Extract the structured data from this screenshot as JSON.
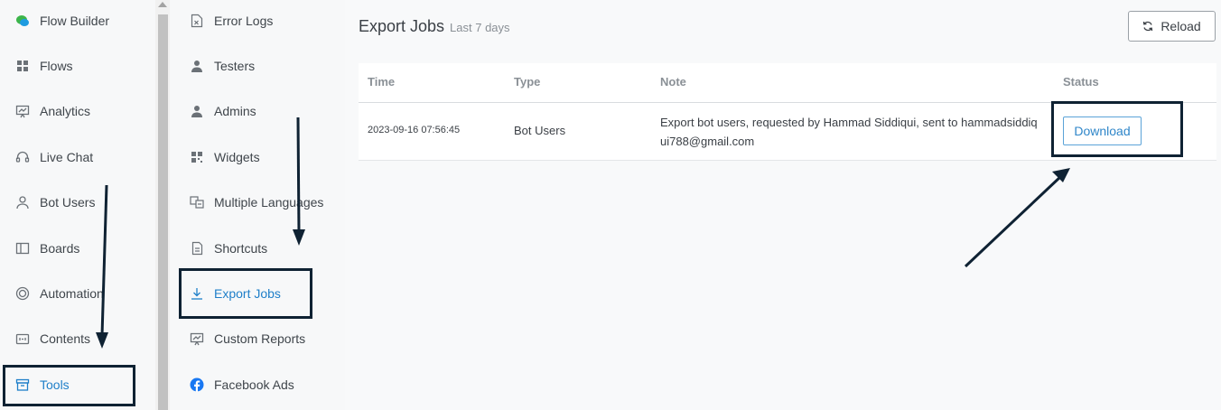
{
  "sidebar": {
    "items": [
      {
        "label": "Flow Builder",
        "icon": "chat-bubble-icon"
      },
      {
        "label": "Flows",
        "icon": "grid-icon"
      },
      {
        "label": "Analytics",
        "icon": "presentation-chart-icon"
      },
      {
        "label": "Live Chat",
        "icon": "headset-icon"
      },
      {
        "label": "Bot Users",
        "icon": "user-icon"
      },
      {
        "label": "Boards",
        "icon": "columns-icon"
      },
      {
        "label": "Automation",
        "icon": "target-icon"
      },
      {
        "label": "Contents",
        "icon": "calendar-icon"
      },
      {
        "label": "Tools",
        "icon": "archive-box-icon",
        "active": true
      }
    ]
  },
  "subnav": {
    "items": [
      {
        "label": "Error Logs",
        "icon": "error-file-icon"
      },
      {
        "label": "Testers",
        "icon": "person-icon"
      },
      {
        "label": "Admins",
        "icon": "person-icon"
      },
      {
        "label": "Widgets",
        "icon": "qr-code-icon"
      },
      {
        "label": "Multiple Languages",
        "icon": "translate-icon"
      },
      {
        "label": "Shortcuts",
        "icon": "document-icon"
      },
      {
        "label": "Export Jobs",
        "icon": "download-icon",
        "active": true
      },
      {
        "label": "Custom Reports",
        "icon": "presentation-chart-icon"
      },
      {
        "label": "Facebook Ads",
        "icon": "facebook-icon"
      }
    ]
  },
  "main": {
    "title": "Export Jobs",
    "subtitle": "Last 7 days",
    "reload_label": "Reload",
    "columns": [
      "Time",
      "Type",
      "Note",
      "Status"
    ],
    "rows": [
      {
        "time": "2023-09-16 07:56:45",
        "type": "Bot Users",
        "note_line1": "Export bot users, requested by Hammad Siddiqui, sent to hammadsiddiq",
        "note_line2": "ui788@gmail.com",
        "status_action": "Download"
      }
    ]
  },
  "colors": {
    "accent": "#1f7fc9",
    "annotation": "#0f2233",
    "sidebar_bg": "#f7f8f9"
  }
}
